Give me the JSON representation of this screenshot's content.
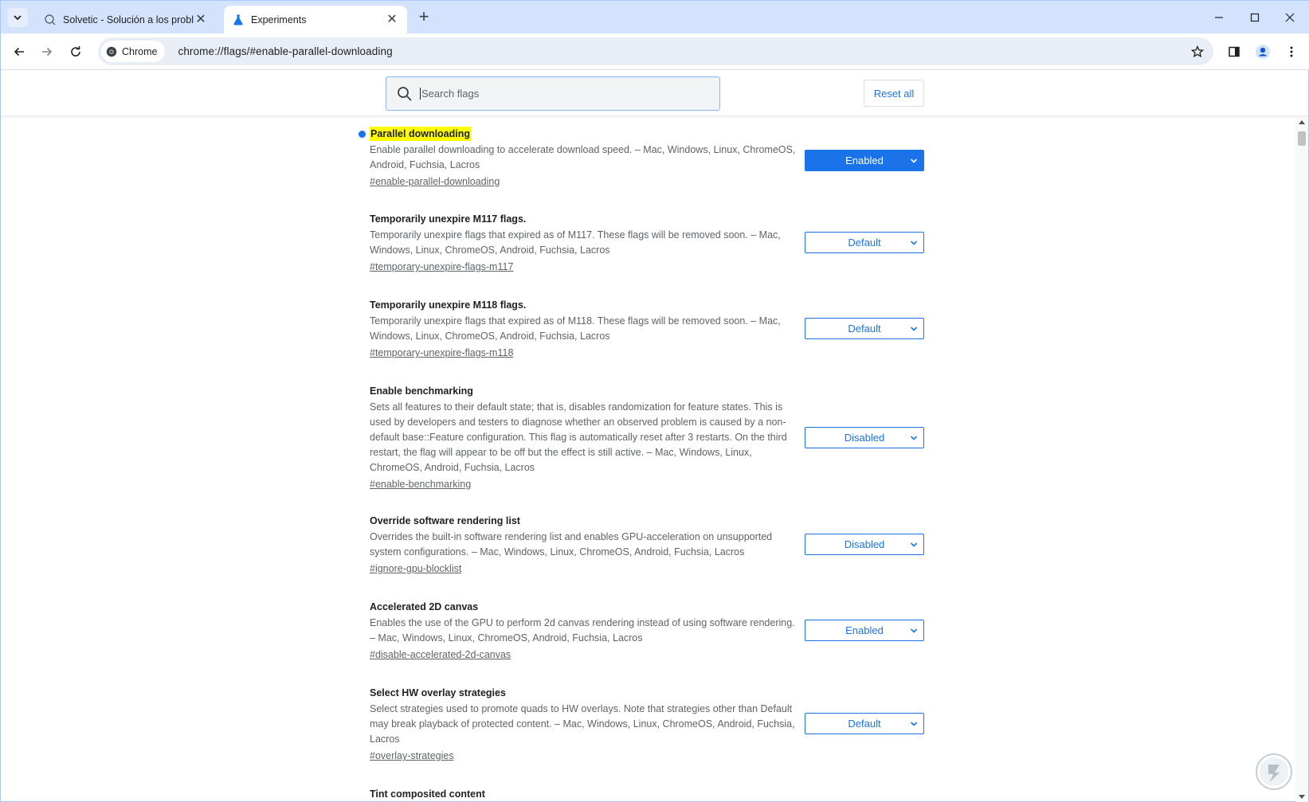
{
  "browser": {
    "tabs": [
      {
        "title": "Solvetic - Solución a los problem",
        "active": false,
        "favicon": "solvetic-icon"
      },
      {
        "title": "Experiments",
        "active": true,
        "favicon": "flask-icon"
      }
    ],
    "omnibox": {
      "chip_label": "Chrome",
      "url": "chrome://flags/#enable-parallel-downloading"
    }
  },
  "flags_page": {
    "search": {
      "placeholder": "Search flags",
      "value": ""
    },
    "reset_label": "Reset all",
    "flags": [
      {
        "title": "Parallel downloading",
        "description": "Enable parallel downloading to accelerate download speed. – Mac, Windows, Linux, ChromeOS, Android, Fuchsia, Lacros",
        "link": "#enable-parallel-downloading",
        "value": "Enabled",
        "highlighted": true,
        "modified": true
      },
      {
        "title": "Temporarily unexpire M117 flags.",
        "description": "Temporarily unexpire flags that expired as of M117. These flags will be removed soon. – Mac, Windows, Linux, ChromeOS, Android, Fuchsia, Lacros",
        "link": "#temporary-unexpire-flags-m117",
        "value": "Default"
      },
      {
        "title": "Temporarily unexpire M118 flags.",
        "description": "Temporarily unexpire flags that expired as of M118. These flags will be removed soon. – Mac, Windows, Linux, ChromeOS, Android, Fuchsia, Lacros",
        "link": "#temporary-unexpire-flags-m118",
        "value": "Default"
      },
      {
        "title": "Enable benchmarking",
        "description": "Sets all features to their default state; that is, disables randomization for feature states. This is used by developers and testers to diagnose whether an observed problem is caused by a non-default base::Feature configuration. This flag is automatically reset after 3 restarts. On the third restart, the flag will appear to be off but the effect is still active. – Mac, Windows, Linux, ChromeOS, Android, Fuchsia, Lacros",
        "link": "#enable-benchmarking",
        "value": "Disabled"
      },
      {
        "title": "Override software rendering list",
        "description": "Overrides the built-in software rendering list and enables GPU-acceleration on unsupported system configurations. – Mac, Windows, Linux, ChromeOS, Android, Fuchsia, Lacros",
        "link": "#ignore-gpu-blocklist",
        "value": "Disabled"
      },
      {
        "title": "Accelerated 2D canvas",
        "description": "Enables the use of the GPU to perform 2d canvas rendering instead of using software rendering. – Mac, Windows, Linux, ChromeOS, Android, Fuchsia, Lacros",
        "link": "#disable-accelerated-2d-canvas",
        "value": "Enabled"
      },
      {
        "title": "Select HW overlay strategies",
        "description": "Select strategies used to promote quads to HW overlays. Note that strategies other than Default may break playback of protected content. – Mac, Windows, Linux, ChromeOS, Android, Fuchsia, Lacros",
        "link": "#overlay-strategies",
        "value": "Default"
      },
      {
        "title": "Tint composited content"
      }
    ]
  }
}
